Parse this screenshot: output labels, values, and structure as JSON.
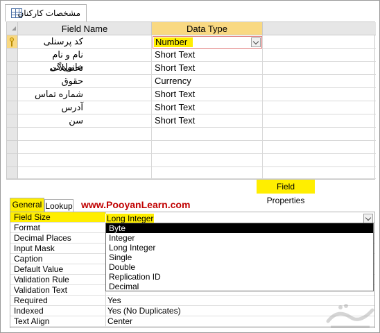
{
  "document_tab": {
    "title": "مشخصات کارکنان",
    "icon": "table-icon"
  },
  "grid": {
    "headers": {
      "field_name": "Field Name",
      "data_type": "Data Type"
    },
    "rows": [
      {
        "name": "کد پرسنلی",
        "type": "Number",
        "primary_key": true
      },
      {
        "name": "نام و نام خانوادگی",
        "type": "Short Text"
      },
      {
        "name": "تحصیلات",
        "type": "Short Text"
      },
      {
        "name": "حقوق",
        "type": "Currency"
      },
      {
        "name": "شماره تماس",
        "type": "Short Text"
      },
      {
        "name": "آدرس",
        "type": "Short Text"
      },
      {
        "name": "سن",
        "type": "Short Text"
      }
    ]
  },
  "field_properties_label": "Field Properties",
  "tabs": {
    "general": "General",
    "lookup": "Lookup"
  },
  "watermark_url": "www.PooyanLearn.com",
  "properties": [
    {
      "label": "Field Size",
      "value": "Long Integer"
    },
    {
      "label": "Format",
      "value": ""
    },
    {
      "label": "Decimal Places",
      "value": ""
    },
    {
      "label": "Input Mask",
      "value": ""
    },
    {
      "label": "Caption",
      "value": ""
    },
    {
      "label": "Default Value",
      "value": ""
    },
    {
      "label": "Validation Rule",
      "value": ""
    },
    {
      "label": "Validation Text",
      "value": ""
    },
    {
      "label": "Required",
      "value": "Yes"
    },
    {
      "label": "Indexed",
      "value": "Yes (No Duplicates)"
    },
    {
      "label": "Text Align",
      "value": "Center"
    }
  ],
  "field_size_dropdown": {
    "current": "Long Integer",
    "options": [
      "Byte",
      "Integer",
      "Long Integer",
      "Single",
      "Double",
      "Replication ID",
      "Decimal"
    ],
    "highlighted": "Byte"
  },
  "colors": {
    "highlight": "#ffee00",
    "header_selected": "#f9d982",
    "url": "#c00000"
  }
}
